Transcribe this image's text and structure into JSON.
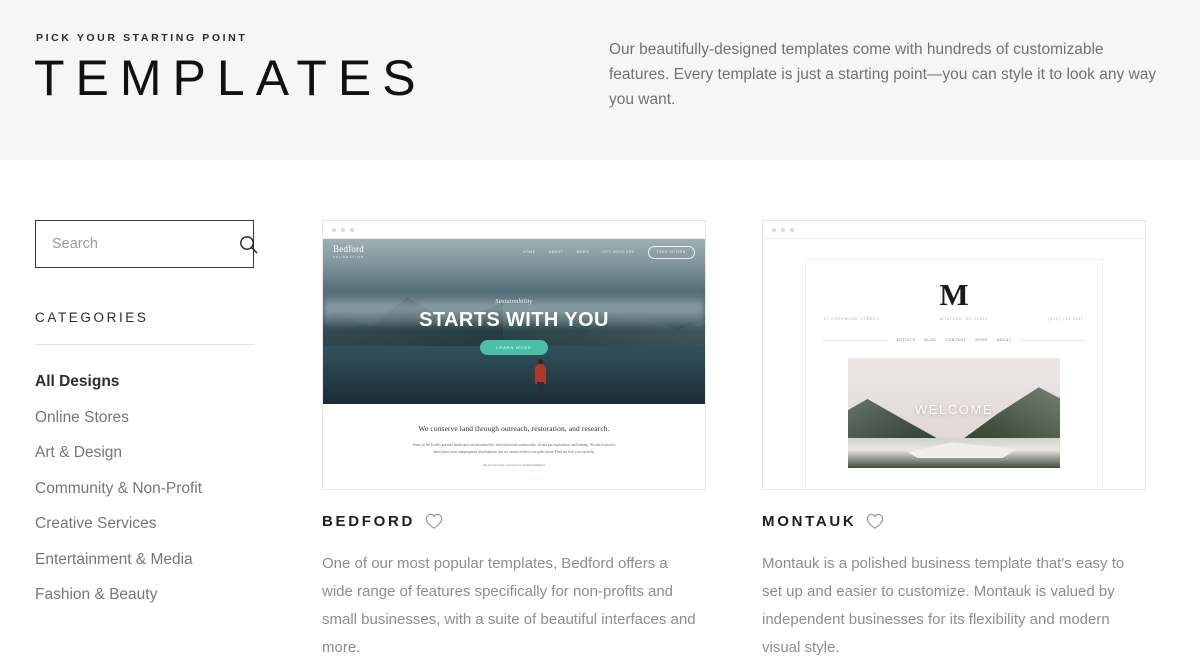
{
  "header": {
    "eyebrow": "PICK YOUR STARTING POINT",
    "title": "TEMPLATES",
    "description": "Our beautifully-designed templates come with hundreds of customizable features. Every template is just a starting point—you can style it to look any way you want."
  },
  "sidebar": {
    "search": {
      "placeholder": "Search",
      "value": "",
      "icon": "search-icon"
    },
    "categories_heading": "CATEGORIES",
    "categories": [
      {
        "label": "All Designs",
        "active": true
      },
      {
        "label": "Online Stores",
        "active": false
      },
      {
        "label": "Art & Design",
        "active": false
      },
      {
        "label": "Community & Non-Profit",
        "active": false
      },
      {
        "label": "Creative Services",
        "active": false
      },
      {
        "label": "Entertainment & Media",
        "active": false
      },
      {
        "label": "Fashion & Beauty",
        "active": false
      }
    ]
  },
  "templates": [
    {
      "name": "BEDFORD",
      "favorite_icon": "heart-icon",
      "description": "One of our most popular templates, Bedford offers a wide range of features specifically for non-profits and small businesses, with a suite of beautiful interfaces and more.",
      "preview": {
        "logo_main": "Bedford",
        "logo_sub": "FOUNDATION",
        "nav": [
          "HOME",
          "ABOUT",
          "NEWS",
          "GET INVOLVED"
        ],
        "nav_cta": "TAKE ACTION",
        "hero_eyebrow": "Sustainability",
        "hero_headline": "STARTS WITH YOU",
        "hero_button": "LEARN MORE",
        "section_heading": "We conserve land through outreach, restoration, and research.",
        "section_paragraph": "Some of the Earth's greatest landscapes are threatened by increased road construction, oil and gas exploration, and mining. We aim to protect these areas from inappropriate development, but we cannot achieve our goals alone. Find out how you can help.",
        "credit_prefix": "All photography provided by ",
        "credit_link": "Jared Chambers"
      }
    },
    {
      "name": "MONTAUK",
      "favorite_icon": "heart-icon",
      "description": "Montauk is a polished business template that's easy to set up and easier to customize. Montauk is valued by independent businesses for its flexibility and modern visual style.",
      "preview": {
        "logo": "M",
        "meta_left": "57 ROSEWOOD STREET",
        "meta_center": "MONTAUK, NY 11954",
        "meta_right": "(800) 123 4567",
        "nav": [
          "ARTISTS",
          "BLOG",
          "CONTACT",
          "SHOP",
          "ABOUT"
        ],
        "photo_caption": "WELCOME"
      }
    }
  ],
  "colors": {
    "header_background": "#f6f6f6",
    "page_background": "#ffffff",
    "accent_teal": "#49bfaa",
    "text_primary": "#1e1e1e",
    "text_muted": "#8a8e90"
  }
}
